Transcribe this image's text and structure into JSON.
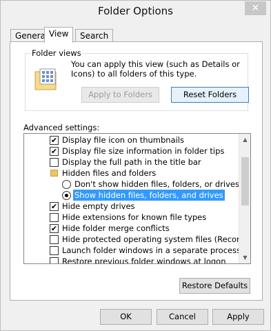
{
  "window": {
    "title": "Folder Options",
    "close_glyph": "✕"
  },
  "tabs": [
    {
      "label": "General"
    },
    {
      "label": "View"
    },
    {
      "label": "Search"
    }
  ],
  "folder_views": {
    "group_label": "Folder views",
    "description": "You can apply this view (such as Details or Icons) to all folders of this type.",
    "apply_button": "Apply to Folders",
    "reset_button": "Reset Folders"
  },
  "advanced": {
    "label": "Advanced settings:",
    "items": [
      {
        "type": "checkbox",
        "checked": true,
        "label": "Display file icon on thumbnails"
      },
      {
        "type": "checkbox",
        "checked": true,
        "label": "Display file size information in folder tips"
      },
      {
        "type": "checkbox",
        "checked": false,
        "label": "Display the full path in the title bar"
      },
      {
        "type": "folder",
        "label": "Hidden files and folders"
      },
      {
        "type": "radio",
        "checked": false,
        "label": "Don't show hidden files, folders, or drives"
      },
      {
        "type": "radio",
        "checked": true,
        "selected": true,
        "label": "Show hidden files, folders, and drives"
      },
      {
        "type": "checkbox",
        "checked": true,
        "label": "Hide empty drives"
      },
      {
        "type": "checkbox",
        "checked": false,
        "label": "Hide extensions for known file types"
      },
      {
        "type": "checkbox",
        "checked": true,
        "label": "Hide folder merge conflicts"
      },
      {
        "type": "checkbox",
        "checked": false,
        "label": "Hide protected operating system files (Recommended)"
      },
      {
        "type": "checkbox",
        "checked": false,
        "label": "Launch folder windows in a separate process"
      },
      {
        "type": "checkbox",
        "checked": false,
        "label": "Restore previous folder windows at logon"
      }
    ],
    "restore_defaults": "Restore Defaults"
  },
  "footer": {
    "ok": "OK",
    "cancel": "Cancel",
    "apply": "Apply"
  },
  "icons": {
    "checkmark": "✔",
    "scroll_up": "▲",
    "scroll_down": "▼"
  }
}
